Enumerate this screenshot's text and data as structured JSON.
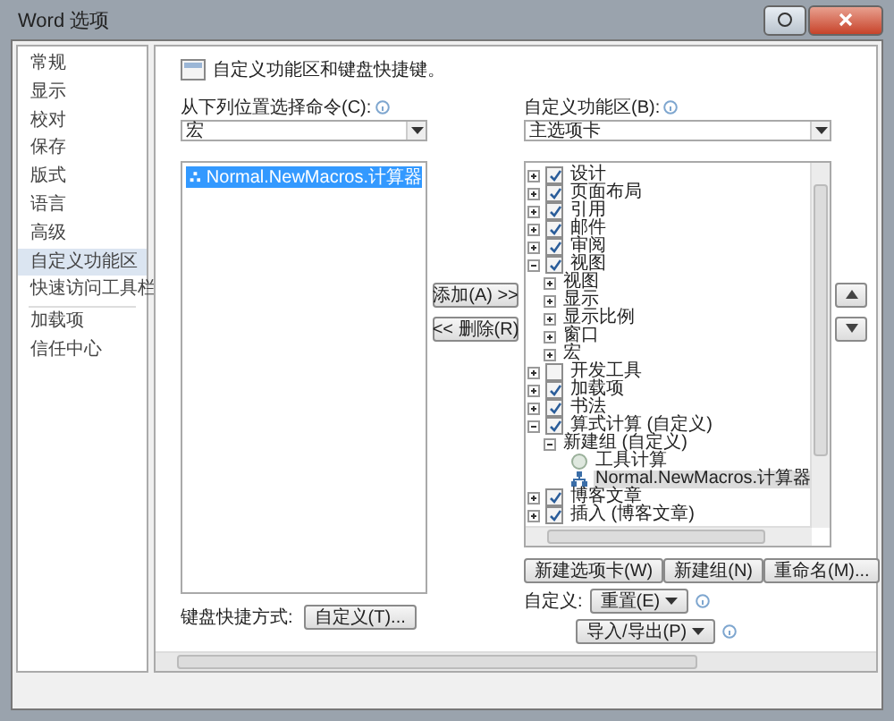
{
  "window": {
    "title": "Word 选项"
  },
  "sidebar": {
    "items": [
      {
        "label": "常规",
        "selected": false,
        "separator_before": false
      },
      {
        "label": "显示",
        "selected": false,
        "separator_before": false
      },
      {
        "label": "校对",
        "selected": false,
        "separator_before": false
      },
      {
        "label": "保存",
        "selected": false,
        "separator_before": false
      },
      {
        "label": "版式",
        "selected": false,
        "separator_before": false
      },
      {
        "label": "语言",
        "selected": false,
        "separator_before": false
      },
      {
        "label": "高级",
        "selected": false,
        "separator_before": false
      },
      {
        "label": "自定义功能区",
        "selected": true,
        "separator_before": false
      },
      {
        "label": "快速访问工具栏",
        "selected": false,
        "separator_before": false
      },
      {
        "label": "加载项",
        "selected": false,
        "separator_before": true
      },
      {
        "label": "信任中心",
        "selected": false,
        "separator_before": false
      }
    ]
  },
  "header": "自定义功能区和键盘快捷键。",
  "commands": {
    "label": "从下列位置选择命令(C):",
    "dropdown": "宏",
    "items": [
      {
        "label": "Normal.NewMacros.计算器",
        "selected": true
      }
    ]
  },
  "shortcuts": {
    "label": "键盘快捷方式:",
    "button": "自定义(T)..."
  },
  "transfer_buttons": [
    "添加(A) >>",
    "<< 删除(R)"
  ],
  "ribbon": {
    "label": "自定义功能区(B):",
    "dropdown": "主选项卡",
    "tree": [
      {
        "label": "设计",
        "kind": "tab",
        "checked": true,
        "expanded": false
      },
      {
        "label": "页面布局",
        "kind": "tab",
        "checked": true,
        "expanded": false
      },
      {
        "label": "引用",
        "kind": "tab",
        "checked": true,
        "expanded": false
      },
      {
        "label": "邮件",
        "kind": "tab",
        "checked": true,
        "expanded": false
      },
      {
        "label": "审阅",
        "kind": "tab",
        "checked": true,
        "expanded": false
      },
      {
        "label": "视图",
        "kind": "tab",
        "checked": true,
        "expanded": true,
        "children": [
          {
            "label": "视图",
            "kind": "group",
            "expanded": false
          },
          {
            "label": "显示",
            "kind": "group",
            "expanded": false
          },
          {
            "label": "显示比例",
            "kind": "group",
            "expanded": false
          },
          {
            "label": "窗口",
            "kind": "group",
            "expanded": false
          },
          {
            "label": "宏",
            "kind": "group",
            "expanded": false
          }
        ]
      },
      {
        "label": "开发工具",
        "kind": "tab",
        "checked": false,
        "expanded": false
      },
      {
        "label": "加载项",
        "kind": "tab",
        "checked": true,
        "expanded": false
      },
      {
        "label": "书法",
        "kind": "tab",
        "checked": true,
        "expanded": false
      },
      {
        "label": "算式计算 (自定义)",
        "kind": "tab",
        "checked": true,
        "expanded": true,
        "children": [
          {
            "label": "新建组 (自定义)",
            "kind": "group",
            "expanded": true,
            "children": [
              {
                "label": "工具计算",
                "kind": "command",
                "selected": false
              },
              {
                "label": "Normal.NewMacros.计算器",
                "kind": "macro",
                "selected": true
              }
            ]
          }
        ]
      },
      {
        "label": "博客文章",
        "kind": "tab",
        "checked": true,
        "expanded": false
      },
      {
        "label": "插入 (博客文章)",
        "kind": "tab",
        "checked": true,
        "expanded": false
      }
    ],
    "buttons": [
      "新建选项卡(W)",
      "新建组(N)",
      "重命名(M)..."
    ],
    "customize_label": "自定义:",
    "reset_button": "重置(E)",
    "import_export_button": "导入/导出(P)"
  }
}
